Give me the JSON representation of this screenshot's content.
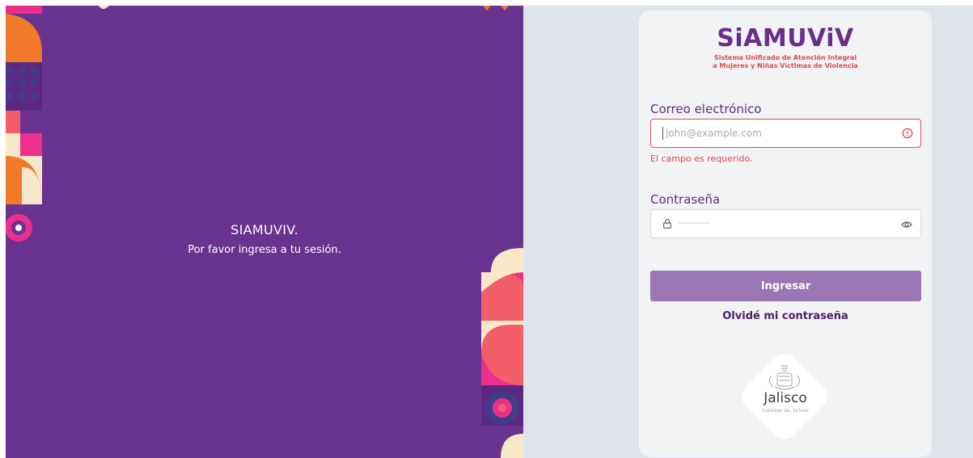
{
  "welcome": {
    "title": "SIAMUVIV.",
    "subtitle": "Por favor ingresa a tu sesión."
  },
  "brand": {
    "name": "SiAMUViV",
    "tagline_line1": "Sistema Unificado de Atención Integral",
    "tagline_line2": "a Mujeres y Niñas Víctimas de Violencia"
  },
  "form": {
    "email_label": "Correo electrónico",
    "email_placeholder": "john@example.com",
    "email_error": "El campo es requerido.",
    "password_label": "Contraseña",
    "password_placeholder": "············",
    "submit_label": "Ingresar",
    "forgot_label": "Olvidé mi contraseña"
  },
  "footer_logo": {
    "name": "Jalisco",
    "sub": "GOBIERNO DEL ESTADO"
  },
  "icons": {
    "error": "alert-circle-icon",
    "lock": "lock-icon",
    "eye": "eye-icon"
  },
  "colors": {
    "purple": "#6a338f",
    "button": "#9a76b4",
    "error": "#e24b57",
    "pink": "#ec2f8a",
    "orange": "#f07a2a",
    "cream": "#f6e8c8",
    "salmon": "#f45e6b"
  }
}
